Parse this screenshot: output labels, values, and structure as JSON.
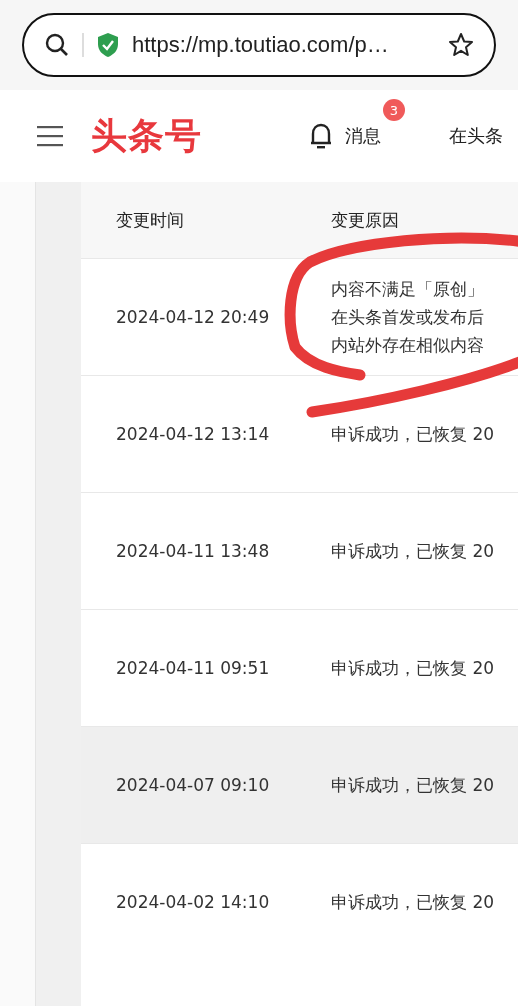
{
  "browser": {
    "url": "https://mp.toutiao.com/p…"
  },
  "header": {
    "logo": "头条号",
    "messages": {
      "label": "消息",
      "badge": "3"
    },
    "nav_item": "在头条"
  },
  "table": {
    "columns": [
      "变更时间",
      "变更原因"
    ],
    "rows": [
      {
        "time": "2024-04-12 20:49",
        "reason": [
          "内容不满足「原创」",
          "在头条首发或发布后",
          "内站外存在相似内容"
        ],
        "highlighted": false
      },
      {
        "time": "2024-04-12 13:14",
        "reason": [
          "申诉成功，已恢复 20"
        ],
        "highlighted": false
      },
      {
        "time": "2024-04-11 13:48",
        "reason": [
          "申诉成功，已恢复 20"
        ],
        "highlighted": false
      },
      {
        "time": "2024-04-11 09:51",
        "reason": [
          "申诉成功，已恢复 20"
        ],
        "highlighted": false
      },
      {
        "time": "2024-04-07 09:10",
        "reason": [
          "申诉成功，已恢复 20"
        ],
        "highlighted": true
      },
      {
        "time": "2024-04-02 14:10",
        "reason": [
          "申诉成功，已恢复 20"
        ],
        "highlighted": false
      }
    ]
  }
}
